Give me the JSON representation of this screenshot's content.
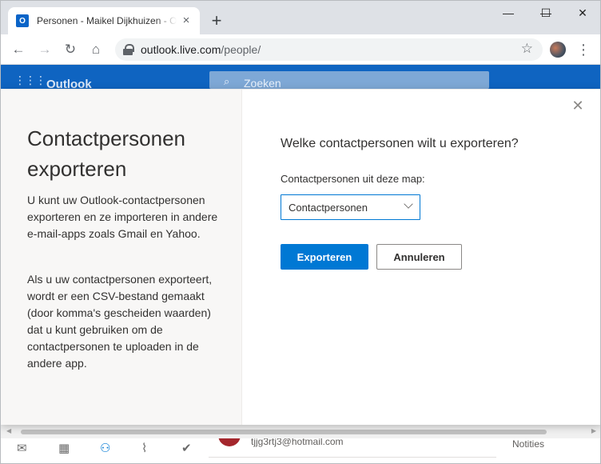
{
  "browser": {
    "tab_title": "Personen - Maikel Dijkhuizen - Outlook",
    "tab_favicon_letter": "O",
    "url_host": "outlook.live.com",
    "url_path": "/people/",
    "icons": {
      "back": "←",
      "forward": "→",
      "reload": "↻",
      "home": "⌂",
      "star": "☆",
      "menu": "⋮",
      "close_tab": "×",
      "new_tab": "+",
      "minimize": "—",
      "maximize": "☐",
      "close_window": "✕"
    }
  },
  "app": {
    "name": "Outlook",
    "search_placeholder": "Zoeken",
    "bottom": {
      "contact_email": "tjjg3rtj3@hotmail.com",
      "notes_label": "Notities"
    }
  },
  "dialog": {
    "title": "Contactpersonen exporteren",
    "paragraph1": "U kunt uw Outlook-contactpersonen exporteren en ze importeren in andere e-mail-apps zoals Gmail en Yahoo.",
    "paragraph2": "Als u uw contactpersonen exporteert, wordt er een CSV-bestand gemaakt (door komma's gescheiden waarden) dat u kunt gebruiken om de contactpersonen te uploaden in de andere app.",
    "question": "Welke contactpersonen wilt u exporteren?",
    "folder_label": "Contactpersonen uit deze map:",
    "folder_selected": "Contactpersonen",
    "export_button": "Exporteren",
    "cancel_button": "Annuleren",
    "close_glyph": "✕"
  },
  "colors": {
    "accent": "#0078d4",
    "header": "#0f64c1"
  }
}
